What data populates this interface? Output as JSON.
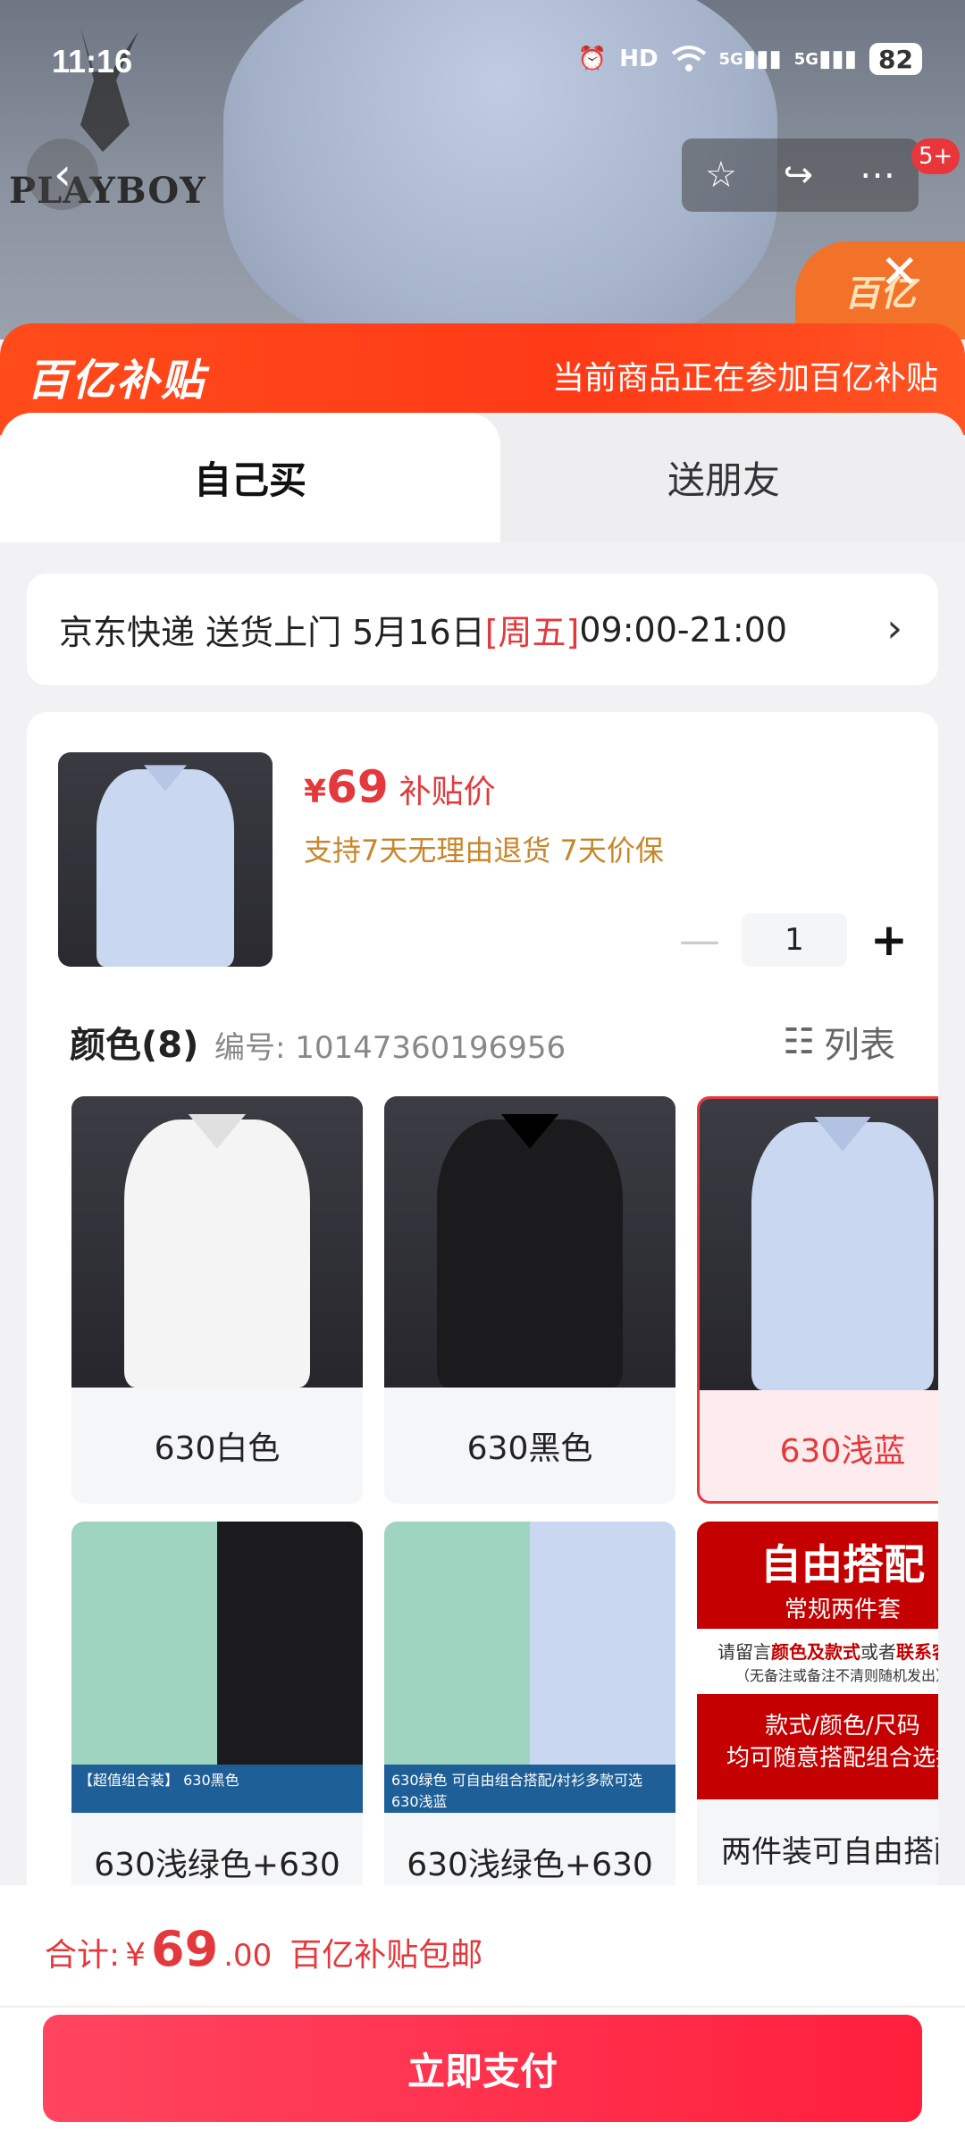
{
  "status": {
    "time": "11:16",
    "battery": "82",
    "network1": "5G",
    "network2": "5G",
    "hd": "HD"
  },
  "top": {
    "brand": "PLAYBOY",
    "badge": "5+",
    "promo_corner": "百亿"
  },
  "banner": {
    "logo": "百亿补贴",
    "text": "当前商品正在参加百亿补贴"
  },
  "tabs": [
    {
      "label": "自己买"
    },
    {
      "label": "送朋友"
    }
  ],
  "delivery": {
    "prefix": "京东快递 送货上门 5月16日 ",
    "weekday": "[周五]",
    "time": " 09:00-21:00"
  },
  "product": {
    "currency": "¥",
    "price": "69",
    "price_tag": "补贴价",
    "policy": "支持7天无理由退货  7天价保",
    "quantity": "1"
  },
  "colors": {
    "heading": "颜色(8)",
    "sku": "编号: 10147360196956",
    "list_toggle": "列表",
    "items": [
      {
        "label": "630白色"
      },
      {
        "label": "630黑色"
      },
      {
        "label": "630浅蓝"
      },
      {
        "label": "630浅绿色+630"
      },
      {
        "label": "630浅绿色+630"
      },
      {
        "label": "两件装可自由搭配"
      }
    ],
    "combo1_strip": "【超值组合装】 630黑色",
    "combo2_strip": "630绿色 可自由组合搭配/衬衫多款可选 630浅蓝",
    "free": {
      "title": "自由搭配",
      "sub": "常规两件套",
      "note_prefix": "请留言",
      "note_red1": "颜色及款式",
      "note_mid": "或者",
      "note_red2": "联系客服",
      "note_small": "（无备注或备注不清则随机发出）",
      "red_line1": "款式/颜色/尺码",
      "red_line2": "均可随意搭配组合选择"
    }
  },
  "bottom": {
    "total_label": "合计: ",
    "currency": "¥",
    "total_int": "69",
    "total_dec": ".00",
    "note": "百亿补贴包邮",
    "pay": "立即支付"
  },
  "theme": {
    "accent": "#e4393c",
    "banner": "#ff4b1a"
  }
}
